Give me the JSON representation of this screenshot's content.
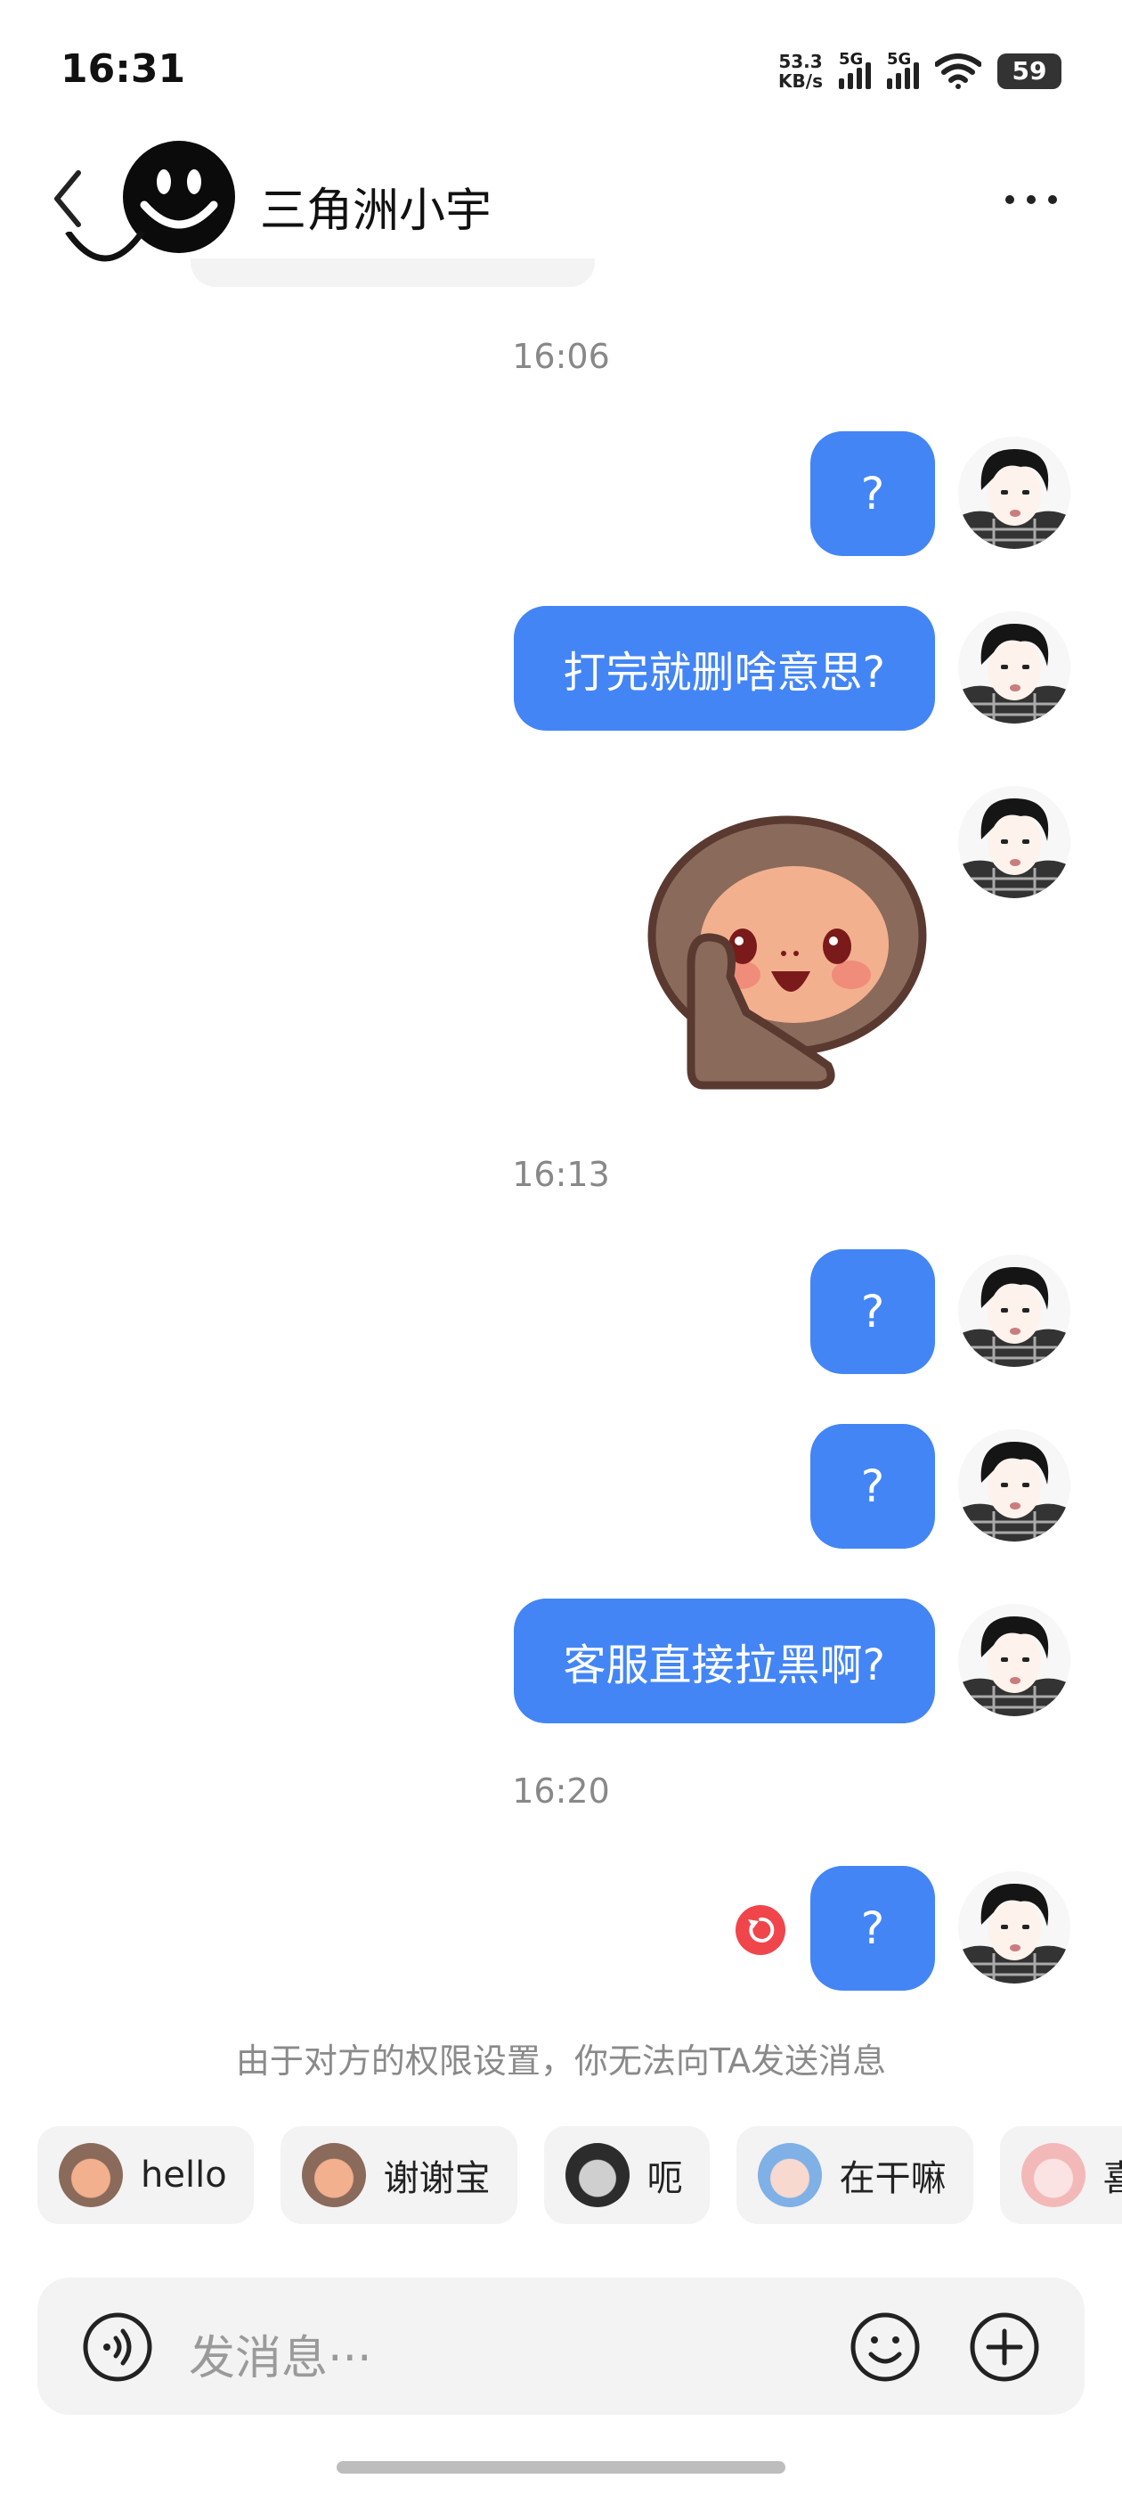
{
  "status": {
    "time": "16:31",
    "net_speed_value": "53.3",
    "net_speed_unit": "KB/s",
    "sim1": "5G",
    "sim2": "5G",
    "battery": "59"
  },
  "header": {
    "contact_name": "三角洲小宇"
  },
  "chat": {
    "timestamps": [
      "16:06",
      "16:13",
      "16:20"
    ],
    "messages": [
      {
        "type": "text",
        "text": "?"
      },
      {
        "type": "text",
        "text": "打完就删啥意思?"
      },
      {
        "type": "sticker"
      },
      {
        "type": "text",
        "text": "?"
      },
      {
        "type": "text",
        "text": "?"
      },
      {
        "type": "text",
        "text": "客服直接拉黑啊?"
      },
      {
        "type": "text",
        "text": "?",
        "status": "failed"
      }
    ]
  },
  "notice": "由于对方的权限设置，你无法向TA发送消息",
  "quick_replies": [
    "hello",
    "谢谢宝",
    "呃",
    "在干嘛",
    "喜"
  ],
  "input": {
    "placeholder": "发消息···"
  },
  "colors": {
    "accent": "#4385f5",
    "error": "#f0454b"
  }
}
